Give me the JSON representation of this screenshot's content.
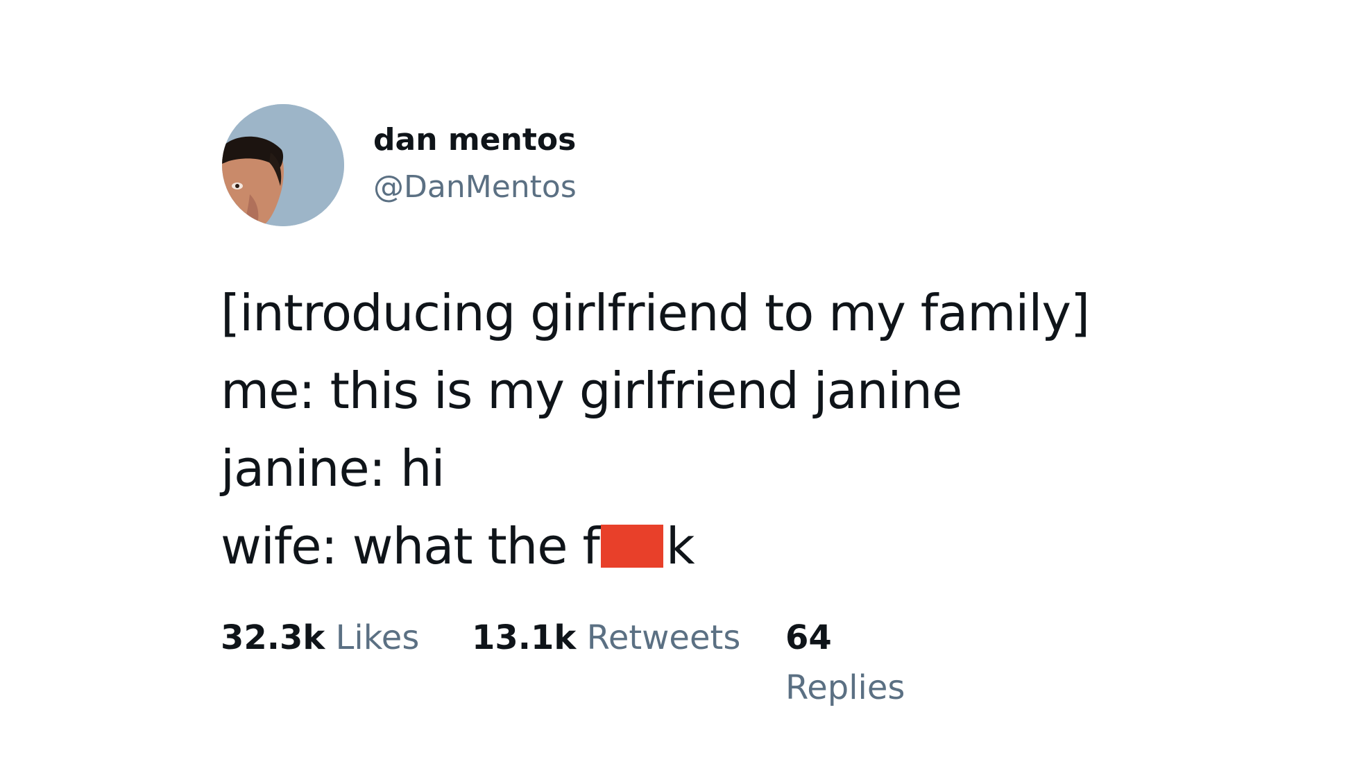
{
  "user": {
    "display_name": "dan mentos",
    "handle": "@DanMentos"
  },
  "tweet": {
    "lines": [
      "[introducing girlfriend to my family]",
      "me: this is my girlfriend janine",
      "janine: hi"
    ],
    "last_line_prefix": "wife: what the f",
    "last_line_suffix": "k"
  },
  "stats": {
    "likes_count": "32.3k",
    "likes_label": "Likes",
    "retweets_count": "13.1k",
    "retweets_label": "Retweets",
    "replies_count": "64",
    "replies_label": "Replies"
  },
  "colors": {
    "avatar_bg": "#9db5c8",
    "censor": "#e8402a",
    "secondary_text": "#5b7083"
  }
}
